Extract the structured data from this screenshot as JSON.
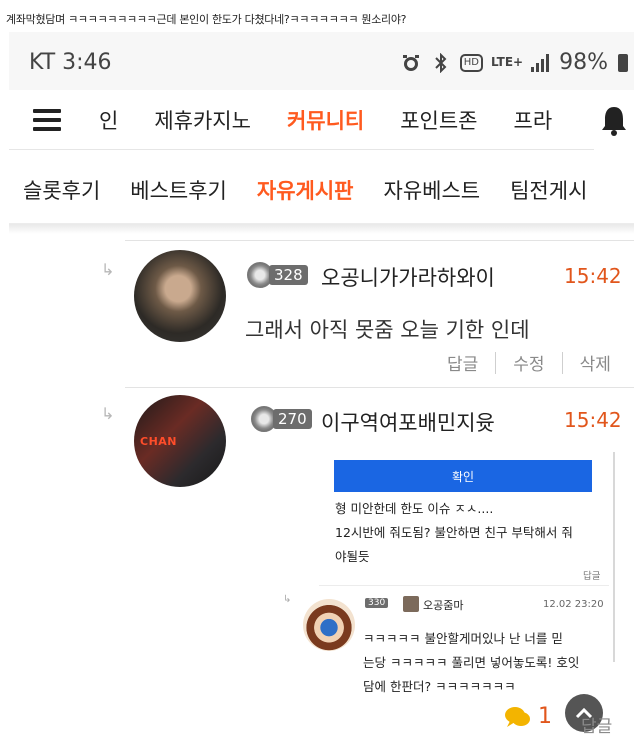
{
  "caption": "계좌막혔담며 ㅋㅋㅋㅋㅋㅋㅋㅋㅋ근데 본인이 한도가 다쳤다네?ㅋㅋㅋㅋㅋㅋㅋ 뭔소리야?",
  "statusbar": {
    "carrier_time": "KT 3:46",
    "lte": "LTE+",
    "hd": "HD",
    "battery": "98%",
    "icons": [
      "alarm-icon",
      "bluetooth-icon",
      "hd-icon",
      "lte-icon",
      "signal-icon",
      "battery-icon"
    ]
  },
  "nav_primary": {
    "items": [
      "인",
      "제휴카지노",
      "커뮤니티",
      "포인트존",
      "프라"
    ],
    "active": "커뮤니티",
    "icons": [
      "menu-icon",
      "bell-icon"
    ]
  },
  "nav_secondary": {
    "items": [
      "슬롯후기",
      "베스트후기",
      "자유게시판",
      "자유베스트",
      "팀전게시"
    ],
    "active": "자유게시판"
  },
  "comments": [
    {
      "level": "328",
      "username": "오공니가가라하와이",
      "time": "15:42",
      "text": "그래서 아직 못줌 오늘 기한 인데",
      "actions": [
        "답글",
        "수정",
        "삭제"
      ]
    },
    {
      "level": "270",
      "username": "이구역여포배민지윳",
      "time": "15:42",
      "avatar_text": "CHAN"
    }
  ],
  "embedded_screenshot": {
    "confirm_label": "확인",
    "line1": "형 미안한데 한도 이슈 ㅈㅅ....",
    "line2": "12시반에 줘도됨? 불안하면 친구 부탁해서 줘",
    "line3": "야될듯",
    "reply_label": "답글",
    "reply": {
      "level": "330",
      "username": "오공줌마",
      "date": "12.02 23:20",
      "line1": "ㅋㅋㅋㅋㅋ 불안할게머있나 난 너를 믿",
      "line2": "는당 ㅋㅋㅋㅋㅋ 풀리면 넣어놓도록! 호잇",
      "line3": "담에 한판더? ㅋㅋㅋㅋㅋㅋㅋ",
      "reply_label": "답글"
    }
  },
  "comment_count": "1",
  "bottom_reply_label": "답글",
  "colors": {
    "accent": "#e1561c",
    "active_nav": "#ff5a1f",
    "confirm_blue": "#1a66e3"
  }
}
